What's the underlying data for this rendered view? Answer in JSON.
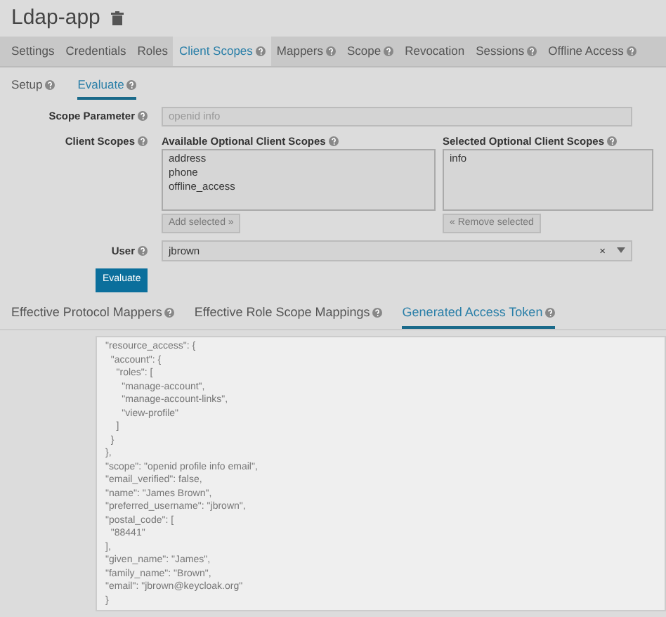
{
  "header": {
    "title": "Ldap-app"
  },
  "tabs": [
    {
      "label": "Settings",
      "help": false,
      "selected": false
    },
    {
      "label": "Credentials",
      "help": false,
      "selected": false
    },
    {
      "label": "Roles",
      "help": false,
      "selected": false
    },
    {
      "label": "Client Scopes",
      "help": true,
      "selected": true
    },
    {
      "label": "Mappers",
      "help": true,
      "selected": false
    },
    {
      "label": "Scope",
      "help": true,
      "selected": false
    },
    {
      "label": "Revocation",
      "help": false,
      "selected": false
    },
    {
      "label": "Sessions",
      "help": true,
      "selected": false
    },
    {
      "label": "Offline Access",
      "help": true,
      "selected": false
    }
  ],
  "subtabs": [
    {
      "label": "Setup",
      "selected": false
    },
    {
      "label": "Evaluate",
      "selected": true
    }
  ],
  "form": {
    "scope_parameter": {
      "label": "Scope Parameter",
      "placeholder": "openid info"
    },
    "client_scopes": {
      "label": "Client Scopes",
      "available": {
        "label": "Available Optional Client Scopes",
        "items": [
          "address",
          "phone",
          "offline_access"
        ],
        "button": "Add selected »"
      },
      "selected": {
        "label": "Selected Optional Client Scopes",
        "items": [
          "info"
        ],
        "button": "« Remove selected"
      }
    },
    "user": {
      "label": "User",
      "value": "jbrown",
      "clear": "×"
    },
    "evaluate_button": "Evaluate"
  },
  "result_tabs": [
    {
      "label": "Effective Protocol Mappers",
      "selected": false
    },
    {
      "label": "Effective Role Scope Mappings",
      "selected": false
    },
    {
      "label": "Generated Access Token",
      "selected": true
    }
  ],
  "token_lines": [
    "\"resource_access\": {",
    "  \"account\": {",
    "    \"roles\": [",
    "      \"manage-account\",",
    "      \"manage-account-links\",",
    "      \"view-profile\"",
    "    ]",
    "  }",
    "},",
    "\"scope\": \"openid profile info email\",",
    "\"email_verified\": false,",
    "\"name\": \"James Brown\",",
    "\"preferred_username\": \"jbrown\",",
    "\"postal_code\": [",
    "  \"88441\"",
    "],",
    "\"given_name\": \"James\",",
    "\"family_name\": \"Brown\",",
    "\"email\": \"jbrown@keycloak.org\"",
    "}"
  ]
}
